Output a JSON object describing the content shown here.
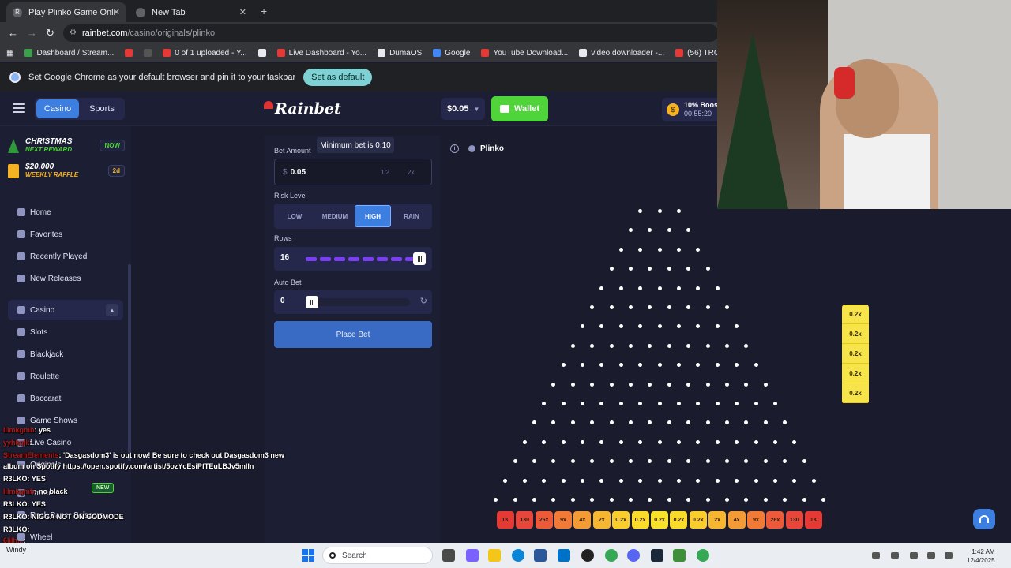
{
  "browser": {
    "tabs": [
      {
        "title": "Play Plinko Game Online for Re",
        "active": true
      },
      {
        "title": "New Tab",
        "active": false
      }
    ],
    "url_host": "rainbet.com",
    "url_path": "/casino/originals/plinko",
    "bookmarks": [
      {
        "label": "Dashboard / Stream...",
        "color": "#3aa14a"
      },
      {
        "label": "",
        "color": "#e53935"
      },
      {
        "label": "",
        "color": "#555"
      },
      {
        "label": "0 of 1 uploaded - Y...",
        "color": "#e53935"
      },
      {
        "label": "",
        "color": "#e8eaed"
      },
      {
        "label": "Live Dashboard - Yo...",
        "color": "#e53935"
      },
      {
        "label": "DumaOS",
        "color": "#e8eaed"
      },
      {
        "label": "Google",
        "color": "#4285f4"
      },
      {
        "label": "YouTube Download...",
        "color": "#e53935"
      },
      {
        "label": "video downloader -...",
        "color": "#e8eaed"
      },
      {
        "label": "(56) TROLLING RAN...",
        "color": "#e53935"
      },
      {
        "label": "DistroKid",
        "color": "#f5b323"
      },
      {
        "label": "Liv",
        "color": "#e53935"
      }
    ],
    "infobar": {
      "message": "Set Google Chrome as your default browser and pin it to your taskbar",
      "button": "Set as default"
    }
  },
  "header": {
    "tabs": [
      "Casino",
      "Sports"
    ],
    "active_tab": "Casino",
    "logo": "Rainbet",
    "balance": "$0.05",
    "wallet": "Wallet",
    "boost": {
      "label": "10% Boost",
      "timer": "00:55:20"
    },
    "accent": "#3d7fe0",
    "wallet_color": "#4fd53a"
  },
  "sidebar": {
    "promos": [
      {
        "title": "CHRISTMAS",
        "subtitle": "NEXT REWARD",
        "badge": "NOW"
      },
      {
        "title": "$20,000",
        "subtitle": "WEEKLY RAFFLE",
        "badge": "2d"
      }
    ],
    "items": [
      {
        "label": "Home",
        "icon": "home-icon"
      },
      {
        "label": "Favorites",
        "icon": "star-icon"
      },
      {
        "label": "Recently Played",
        "icon": "clock-icon"
      },
      {
        "label": "New Releases",
        "icon": "sparkle-icon"
      },
      {
        "label": "Casino",
        "icon": "dice-icon"
      },
      {
        "label": "Slots",
        "icon": "slot-icon"
      },
      {
        "label": "Blackjack",
        "icon": "cards-icon"
      },
      {
        "label": "Roulette",
        "icon": "roulette-icon"
      },
      {
        "label": "Baccarat",
        "icon": "baccarat-icon"
      },
      {
        "label": "Game Shows",
        "icon": "mic-icon"
      },
      {
        "label": "Live Casino",
        "icon": "live-icon"
      },
      {
        "label": "Originals",
        "icon": "gem-icon"
      },
      {
        "label": "Tower",
        "icon": "tower-icon"
      },
      {
        "label": "Rock Paper Scissors",
        "icon": "hand-icon"
      },
      {
        "label": "Wheel",
        "icon": "wheel-icon"
      }
    ],
    "new_tag": "NEW"
  },
  "bet": {
    "amount_label": "Bet Amount",
    "tooltip": "Minimum bet is 0.10",
    "currency": "$",
    "amount": "0.05",
    "half": "1/2",
    "double": "2x",
    "risk_label": "Risk Level",
    "risk_options": [
      "LOW",
      "MEDIUM",
      "HIGH",
      "RAIN"
    ],
    "risk_selected": "HIGH",
    "rows_label": "Rows",
    "rows": "16",
    "rows_fraction": 1.0,
    "autobet_label": "Auto Bet",
    "autobet": "0",
    "autobet_fraction": 0.0,
    "place_bet": "Place Bet"
  },
  "game": {
    "title": "Plinko",
    "peg_rows": 16,
    "multipliers": [
      "1K",
      "130",
      "26x",
      "9x",
      "4x",
      "2x",
      "0.2x",
      "0.2x",
      "0.2x",
      "0.2x",
      "0.2x",
      "2x",
      "4x",
      "9x",
      "26x",
      "130",
      "1K"
    ],
    "slot_colors": [
      "#e53935",
      "#e8463a",
      "#ec5a3a",
      "#f07a36",
      "#f39b34",
      "#f6b62f",
      "#f8cd2c",
      "#f9dc2a",
      "#f9e32a",
      "#f9dc2a",
      "#f8cd2c",
      "#f6b62f",
      "#f39b34",
      "#f07a36",
      "#ec5a3a",
      "#e8463a",
      "#e53935"
    ],
    "history": [
      "0.2x",
      "0.2x",
      "0.2x",
      "0.2x",
      "0.2x"
    ]
  },
  "chat": [
    {
      "user": "lilmkgmb",
      "text": ": yes"
    },
    {
      "user": "yyhkqlk",
      "text": ":"
    },
    {
      "user": "StreamElements",
      "text": ": 'Dasgasdom3' is out now! Be sure to check out Dasgasdom3 new"
    },
    {
      "user": "",
      "text": "album on Spotify https://open.spotify.com/artist/5ozYcEsiPfTEuLBJv5mlln"
    },
    {
      "user": "R3LKO",
      "text": ": YES"
    },
    {
      "user": "lilmkgmb",
      "text": ": no black"
    },
    {
      "user": "R3LKO",
      "text": ": YES"
    },
    {
      "user": "R3LKO",
      "text": ": NIGGA NOT ON GODMODE"
    },
    {
      "user": "R3LKO",
      "text": ":"
    },
    {
      "user": "6lilh...",
      "text": ":"
    }
  ],
  "taskbar": {
    "weather": "Windy",
    "search": "Search",
    "time": "1:42 AM",
    "date": "12/4/2025"
  }
}
